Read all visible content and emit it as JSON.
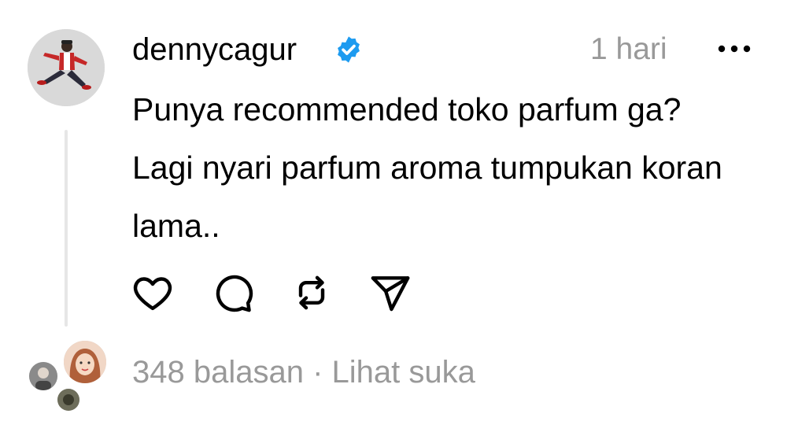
{
  "post": {
    "username": "dennycagur",
    "verified": true,
    "timestamp": "1 hari",
    "text": "Punya recommended toko parfum ga? Lagi nyari parfum aroma tumpukan koran lama..",
    "replies_count_label": "348 balasan",
    "separator": "·",
    "view_likes_label": "Lihat suka"
  },
  "icons": {
    "verified": "verified-badge-icon",
    "more": "more-options-icon",
    "like": "heart-icon",
    "comment": "comment-bubble-icon",
    "repost": "repost-icon",
    "share": "send-icon"
  },
  "colors": {
    "primary_text": "#000000",
    "secondary_text": "#999999",
    "verified_badge": "#1d9bf0",
    "thread_line": "#e6e6e6"
  }
}
